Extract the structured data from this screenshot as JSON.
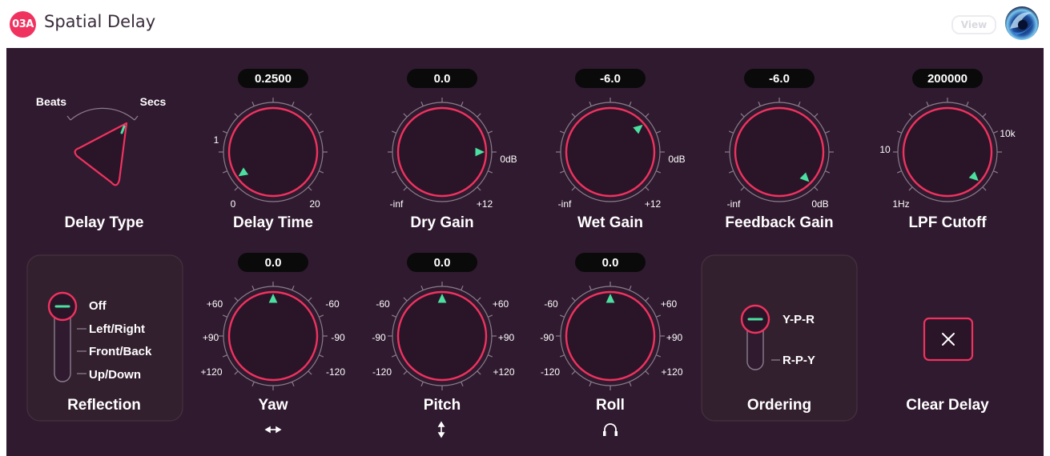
{
  "app": {
    "badge": "03A",
    "title": "Spatial Delay",
    "view_button": "View",
    "brand_icon": "swirl-logo-icon"
  },
  "delay_type": {
    "label": "Delay Type",
    "option_left": "Beats",
    "option_right": "Secs"
  },
  "knobs": {
    "delay_time": {
      "label": "Delay Time",
      "value": "0.2500",
      "ticks": [
        "1",
        "0",
        "20"
      ]
    },
    "dry_gain": {
      "label": "Dry Gain",
      "value": "0.0",
      "ticks": [
        "0dB",
        "-inf",
        "+12"
      ]
    },
    "wet_gain": {
      "label": "Wet Gain",
      "value": "-6.0",
      "ticks": [
        "0dB",
        "-inf",
        "+12"
      ]
    },
    "feedback_gain": {
      "label": "Feedback Gain",
      "value": "-6.0",
      "ticks": [
        "-inf",
        "0dB"
      ]
    },
    "lpf_cutoff": {
      "label": "LPF Cutoff",
      "value": "200000",
      "ticks": [
        "10",
        "10k",
        "1Hz"
      ]
    },
    "yaw": {
      "label": "Yaw",
      "value": "0.0",
      "icon": "left-right-arrow-icon",
      "ticks": [
        "+60",
        "-60",
        "+90",
        "-90",
        "+120",
        "-120"
      ]
    },
    "pitch": {
      "label": "Pitch",
      "value": "0.0",
      "icon": "up-down-arrow-icon",
      "ticks": [
        "-60",
        "+60",
        "-90",
        "+90",
        "-120",
        "+120"
      ]
    },
    "roll": {
      "label": "Roll",
      "value": "0.0",
      "icon": "headphones-icon",
      "ticks": [
        "-60",
        "+60",
        "-90",
        "+90",
        "-120",
        "+120"
      ]
    }
  },
  "reflection": {
    "label": "Reflection",
    "options": [
      "Off",
      "Left/Right",
      "Front/Back",
      "Up/Down"
    ],
    "selected": "Off"
  },
  "ordering": {
    "label": "Ordering",
    "options": [
      "Y-P-R",
      "R-P-Y"
    ],
    "selected": "Y-P-R"
  },
  "clear_delay": {
    "label": "Clear Delay",
    "icon": "close-x-icon"
  },
  "colors": {
    "panel_bg": "#301a2f",
    "accent": "#f0325f",
    "pointer": "#4be0a0",
    "text": "#ffffff"
  }
}
